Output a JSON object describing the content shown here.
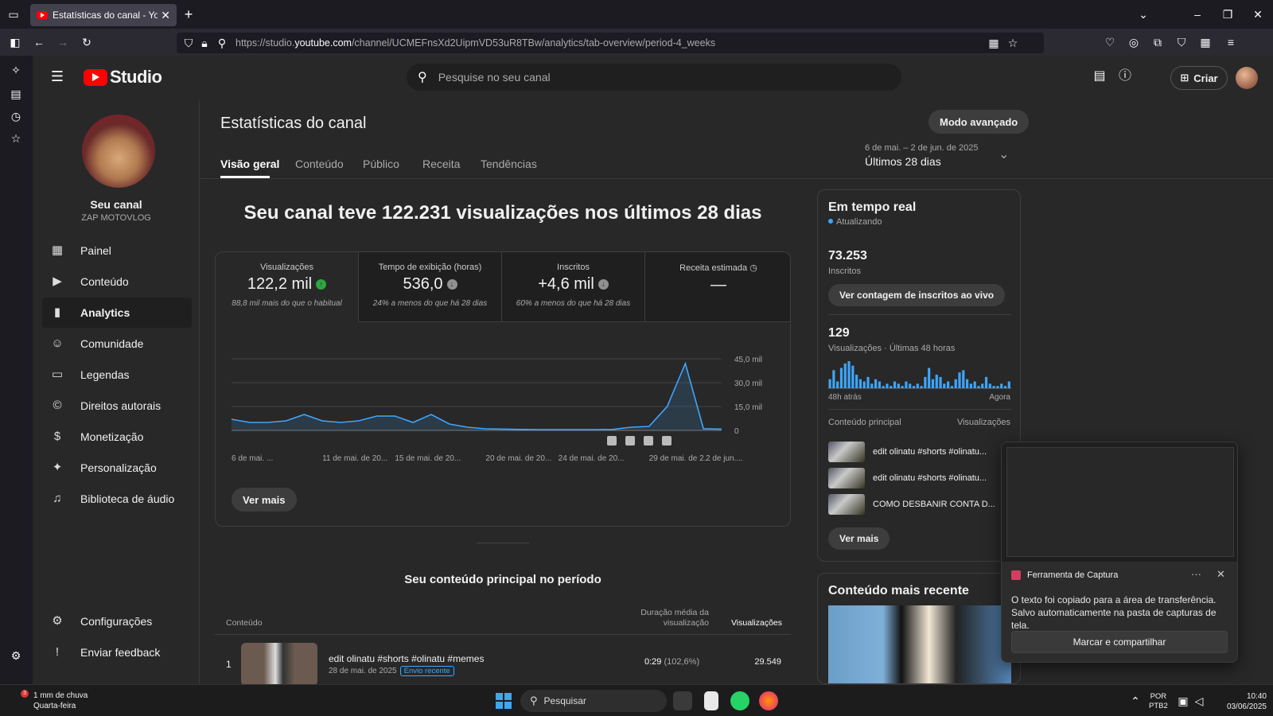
{
  "browser": {
    "tab_title": "Estatísticas do canal - YouTube",
    "url_prefix": "https://studio.",
    "url_domain": "youtube.com",
    "url_path": "/channel/UCMEFnsXd2UipmVD53uR8TBw/analytics/tab-overview/period-4_weeks"
  },
  "header": {
    "logo_text": "Studio",
    "search_placeholder": "Pesquise no seu canal",
    "create_label": "Criar"
  },
  "channel": {
    "name": "Seu canal",
    "handle": "ZAP MOTOVLOG"
  },
  "nav": {
    "items": [
      {
        "label": "Painel",
        "icon": "dashboard-icon"
      },
      {
        "label": "Conteúdo",
        "icon": "content-icon"
      },
      {
        "label": "Analytics",
        "icon": "analytics-icon"
      },
      {
        "label": "Comunidade",
        "icon": "community-icon"
      },
      {
        "label": "Legendas",
        "icon": "subtitles-icon"
      },
      {
        "label": "Direitos autorais",
        "icon": "copyright-icon"
      },
      {
        "label": "Monetização",
        "icon": "dollar-icon"
      },
      {
        "label": "Personalização",
        "icon": "magic-wand-icon"
      },
      {
        "label": "Biblioteca de áudio",
        "icon": "audio-library-icon"
      }
    ],
    "settings_label": "Configurações",
    "feedback_label": "Enviar feedback"
  },
  "page": {
    "title": "Estatísticas do canal",
    "advanced_mode": "Modo avançado",
    "tabs": [
      "Visão geral",
      "Conteúdo",
      "Público",
      "Receita",
      "Tendências"
    ],
    "period_range": "6 de mai. – 2 de jun. de 2025",
    "period_label": "Últimos 28 dias",
    "headline": "Seu canal teve 122.231 visualizações nos últimos 28 dias"
  },
  "metrics": [
    {
      "label": "Visualizações",
      "value": "122,2 mil",
      "sub": "88,8 mil mais do que o habitual",
      "trend": "up",
      "color": "#2ba640"
    },
    {
      "label": "Tempo de exibição (horas)",
      "value": "536,0",
      "sub": "24% a menos do que há 28 dias",
      "trend": "down",
      "color": "#909090"
    },
    {
      "label": "Inscritos",
      "value": "+4,6 mil",
      "sub": "60% a menos do que há 28 dias",
      "trend": "down",
      "color": "#909090"
    },
    {
      "label": "Receita estimada",
      "value": "—",
      "sub": "",
      "trend": "",
      "color": ""
    }
  ],
  "chart_data": {
    "type": "area",
    "x": [
      "6 de mai.",
      "7",
      "8",
      "9",
      "10",
      "11",
      "12",
      "13",
      "14",
      "15",
      "16",
      "17",
      "18",
      "19",
      "20",
      "21",
      "22",
      "23",
      "24",
      "25",
      "26",
      "27",
      "28",
      "29",
      "30",
      "31",
      "1",
      "2"
    ],
    "x_tick_labels": [
      "6 de mai. ...",
      "11 de mai. de 20...",
      "15 de mai. de 20...",
      "20 de mai. de 20...",
      "24 de mai. de 20...",
      "29 de mai. de 2...",
      "2 de jun...."
    ],
    "series": [
      {
        "values": [
          7000,
          5000,
          5000,
          6000,
          10000,
          6000,
          5000,
          6000,
          9000,
          9000,
          5000,
          10000,
          4000,
          2000,
          1000,
          800,
          600,
          500,
          500,
          500,
          500,
          600,
          2000,
          2500,
          15000,
          42000,
          1000,
          800
        ]
      }
    ],
    "y_tick_labels": [
      "0",
      "15,0 mil",
      "30,0 mil",
      "45,0 mil"
    ],
    "ylim": [
      0,
      45000
    ],
    "grid": true,
    "color": "#3ea6ff"
  },
  "chart_more": "Ver mais",
  "realtime": {
    "title": "Em tempo real",
    "updating": "Atualizando",
    "subs_value": "73.253",
    "subs_label": "Inscritos",
    "live_count_btn": "Ver contagem de inscritos ao vivo",
    "views_value": "129",
    "views_label": "Visualizações · Últimas 48 horas",
    "bars": [
      4,
      8,
      3,
      9,
      11,
      12,
      10,
      6,
      4,
      3,
      5,
      2,
      4,
      3,
      1,
      2,
      1,
      3,
      2,
      1,
      3,
      2,
      1,
      2,
      1,
      5,
      9,
      4,
      6,
      5,
      2,
      3,
      1,
      4,
      7,
      8,
      4,
      2,
      3,
      1,
      2,
      5,
      2,
      1,
      1,
      2,
      1,
      3
    ],
    "start_label": "48h atrás",
    "end_label": "Agora",
    "top_label": "Conteúdo principal",
    "top_col": "Visualizações",
    "videos": [
      "edit olinatu #shorts #olinatu...",
      "edit olinatu #shorts #olinatu...",
      "COMO DESBANIR CONTA D..."
    ],
    "more_btn": "Ver mais"
  },
  "recent": {
    "title": "Conteúdo mais recente"
  },
  "top_content": {
    "title": "Seu conteúdo principal no período",
    "col_content": "Conteúdo",
    "col_duration": "Duração média da visualização",
    "col_views": "Visualizações",
    "rows": [
      {
        "rank": "1",
        "title": "edit olinatu #shorts #olinatu #memes",
        "date": "28 de mai. de 2025",
        "badge": "Envio recente",
        "duration": "0:29",
        "duration_pct": "(102,6%)",
        "views": "29.549"
      }
    ]
  },
  "toast": {
    "app": "Ferramenta de Captura",
    "message": "O texto foi copiado para a área de transferência. Salvo automaticamente na pasta de capturas de tela.",
    "button": "Marcar e compartilhar"
  },
  "taskbar": {
    "weather_badge": "3",
    "weather_line1": "1 mm de chuva",
    "weather_line2": "Quarta-feira",
    "search": "Pesquisar",
    "lang1": "POR",
    "lang2": "PTB2",
    "time": "10:40",
    "date": "03/06/2025"
  }
}
